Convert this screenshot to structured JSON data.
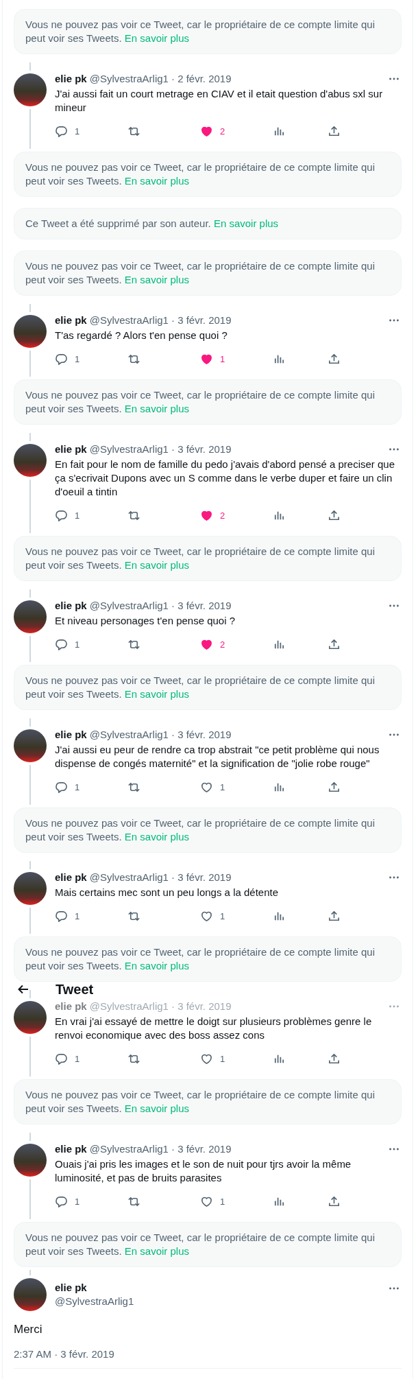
{
  "header": {
    "title": "Tweet"
  },
  "items": [
    {
      "kind": "notice",
      "text": "Vous ne pouvez pas voir ce Tweet, car le propriétaire de ce compte limite qui peut voir ses Tweets.",
      "link": "En savoir plus"
    },
    {
      "kind": "tweet",
      "name": "elie pk",
      "handle": "@SylvestraArlig1",
      "date": "· 2 févr. 2019",
      "text": "J'ai aussi fait un court metrage en CIAV et il etait question d'abus sxl sur mineur",
      "replies": "1",
      "likes": "2",
      "liked": true,
      "covered": false
    },
    {
      "kind": "notice",
      "text": "Vous ne pouvez pas voir ce Tweet, car le propriétaire de ce compte limite qui peut voir ses Tweets.",
      "link": "En savoir plus"
    },
    {
      "kind": "notice",
      "text": "Ce Tweet a été supprimé par son auteur.",
      "link": "En savoir plus"
    },
    {
      "kind": "notice",
      "text": "Vous ne pouvez pas voir ce Tweet, car le propriétaire de ce compte limite qui peut voir ses Tweets.",
      "link": "En savoir plus"
    },
    {
      "kind": "tweet",
      "name": "elie pk",
      "handle": "@SylvestraArlig1",
      "date": "· 3 févr. 2019",
      "text": "T'as regardé ? Alors t'en pense quoi ?",
      "replies": "1",
      "likes": "1",
      "liked": true,
      "covered": false
    },
    {
      "kind": "notice",
      "text": "Vous ne pouvez pas voir ce Tweet, car le propriétaire de ce compte limite qui peut voir ses Tweets.",
      "link": "En savoir plus"
    },
    {
      "kind": "tweet",
      "name": "elie pk",
      "handle": "@SylvestraArlig1",
      "date": "· 3 févr. 2019",
      "text": "En fait pour le nom de famille du pedo j'avais d'abord pensé a preciser que ça s'ecrivait Dupons avec un S comme dans le verbe duper et faire un clin d'oeuil a tintin",
      "replies": "1",
      "likes": "2",
      "liked": true,
      "covered": false
    },
    {
      "kind": "notice",
      "text": "Vous ne pouvez pas voir ce Tweet, car le propriétaire de ce compte limite qui peut voir ses Tweets.",
      "link": "En savoir plus"
    },
    {
      "kind": "tweet",
      "name": "elie pk",
      "handle": "@SylvestraArlig1",
      "date": "· 3 févr. 2019",
      "text": "Et niveau personages t'en pense quoi ?",
      "replies": "1",
      "likes": "2",
      "liked": true,
      "covered": false
    },
    {
      "kind": "notice",
      "text": "Vous ne pouvez pas voir ce Tweet, car le propriétaire de ce compte limite qui peut voir ses Tweets.",
      "link": "En savoir plus"
    },
    {
      "kind": "tweet",
      "name": "elie pk",
      "handle": "@SylvestraArlig1",
      "date": "· 3 févr. 2019",
      "text": "J'ai aussi eu peur de rendre ca trop abstrait \"ce petit problème qui nous dispense de congés maternité\" et la signification de \"jolie robe rouge\"",
      "replies": "1",
      "likes": "1",
      "liked": false,
      "covered": false
    },
    {
      "kind": "notice",
      "text": "Vous ne pouvez pas voir ce Tweet, car le propriétaire de ce compte limite qui peut voir ses Tweets.",
      "link": "En savoir plus"
    },
    {
      "kind": "tweet",
      "name": "elie pk",
      "handle": "@SylvestraArlig1",
      "date": "· 3 févr. 2019",
      "text": "Mais certains mec sont un peu longs a la détente",
      "replies": "1",
      "likes": "1",
      "liked": false,
      "covered": false
    },
    {
      "kind": "notice",
      "text": "Vous ne pouvez pas voir ce Tweet, car le propriétaire de ce compte limite qui peut voir ses Tweets.",
      "link": "En savoir plus"
    },
    {
      "kind": "tweet",
      "name": "elie pk",
      "handle": "@SylvestraArlig1",
      "date": "· 3 févr. 2019",
      "text": "En vrai j'ai essayé de mettre le doigt sur plusieurs problèmes genre le renvoi economique avec des boss assez cons",
      "replies": "1",
      "likes": "1",
      "liked": false,
      "covered": true
    },
    {
      "kind": "notice",
      "text": "Vous ne pouvez pas voir ce Tweet, car le propriétaire de ce compte limite qui peut voir ses Tweets.",
      "link": "En savoir plus"
    },
    {
      "kind": "tweet",
      "name": "elie pk",
      "handle": "@SylvestraArlig1",
      "date": "· 3 févr. 2019",
      "text": "Ouais j'ai pris les images et le son de nuit pour tjrs avoir la même luminosité, et pas de bruits parasites",
      "replies": "1",
      "likes": "1",
      "liked": false,
      "covered": false
    },
    {
      "kind": "notice",
      "text": "Vous ne pouvez pas voir ce Tweet, car le propriétaire de ce compte limite qui peut voir ses Tweets.",
      "link": "En savoir plus"
    },
    {
      "kind": "main",
      "name": "elie pk",
      "handle": "@SylvestraArlig1",
      "text": "Merci",
      "timestamp": "2:37 AM · 3 févr. 2019"
    }
  ]
}
